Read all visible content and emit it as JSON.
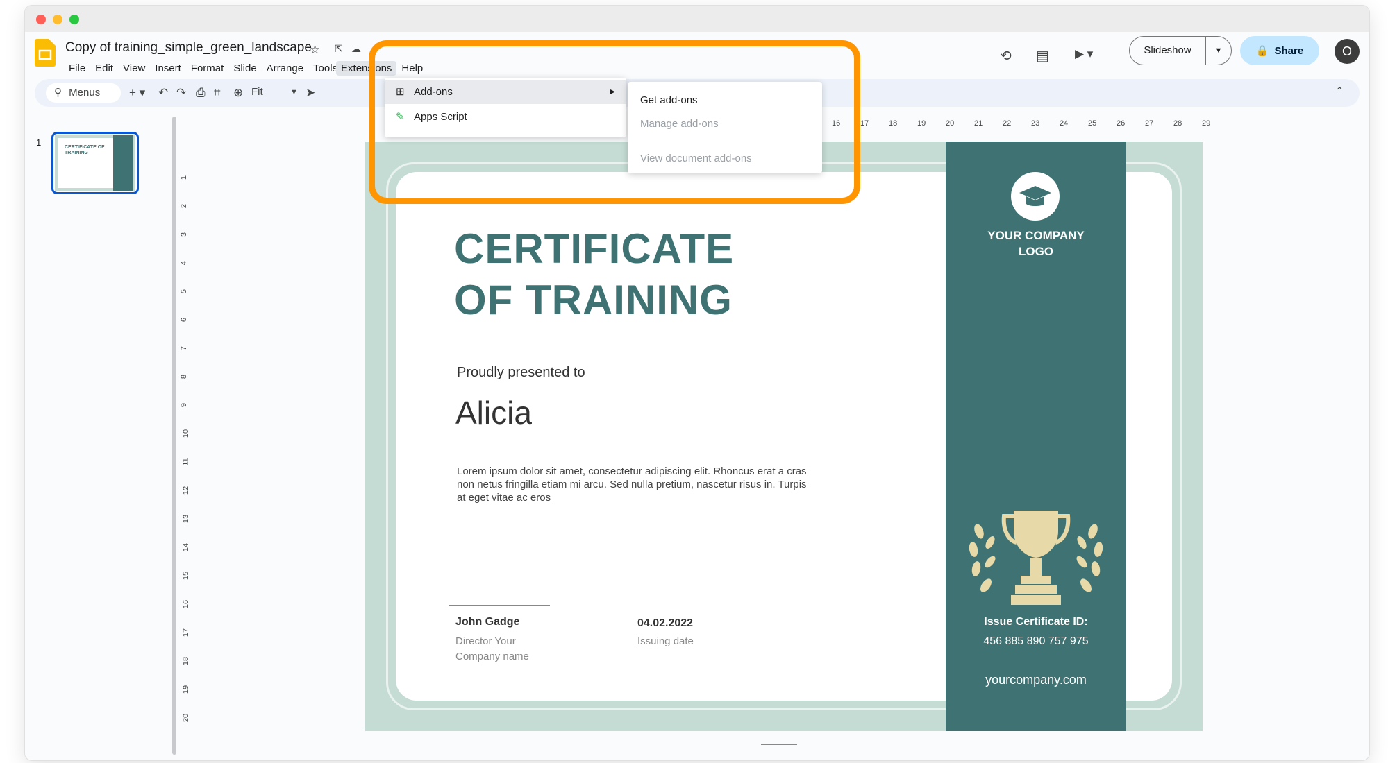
{
  "window": {
    "title": "Copy of training_simple_green_landscape"
  },
  "menubar": [
    "File",
    "Edit",
    "View",
    "Insert",
    "Format",
    "Slide",
    "Arrange",
    "Tools",
    "Extensions",
    "Help"
  ],
  "toolbar": {
    "search_label": "Menus",
    "zoom": "Fit"
  },
  "header": {
    "slideshow_label": "Slideshow",
    "share_label": "Share",
    "avatar_initial": "O"
  },
  "extensions_menu": {
    "items": [
      {
        "label": "Add-ons",
        "icon": "add-ons-icon"
      },
      {
        "label": "Apps Script",
        "icon": "apps-script-icon"
      }
    ],
    "submenu": [
      "Get add-ons",
      "Manage add-ons",
      "View document add-ons"
    ]
  },
  "filmstrip": {
    "slide_number": "1",
    "thumb_title": "CERTIFICATE OF TRAINING"
  },
  "ruler": {
    "horizontal": [
      "16",
      "17",
      "18",
      "19",
      "20",
      "21",
      "22",
      "23",
      "24",
      "25",
      "26",
      "27",
      "28",
      "29"
    ],
    "vertical": [
      "1",
      "2",
      "3",
      "4",
      "5",
      "6",
      "7",
      "8",
      "9",
      "10",
      "11",
      "12",
      "13",
      "14",
      "15",
      "16",
      "17",
      "18",
      "19",
      "20"
    ]
  },
  "slide": {
    "title_line1": "CERTIFICATE",
    "title_line2": "OF TRAINING",
    "presented": "Proudly presented to",
    "recipient": "Alicia",
    "body": "Lorem ipsum dolor sit amet, consectetur adipiscing elit. Rhoncus erat a cras non netus fringilla etiam mi arcu. Sed nulla pretium, nascetur risus in. Turpis at eget vitae ac eros",
    "signer_name": "John Gadge",
    "signer_role": "Director Your Company name",
    "date": "04.02.2022",
    "date_label": "Issuing date",
    "logo_line1": "YOUR COMPANY",
    "logo_line2": "LOGO",
    "cert_id_label": "Issue Certificate ID:",
    "cert_id": "456 885 890 757 975",
    "website": "yourcompany.com"
  },
  "colors": {
    "accent": "#3f7373",
    "highlight": "#ff9500",
    "share": "#c2e7ff",
    "border": "#c4dcd4"
  }
}
